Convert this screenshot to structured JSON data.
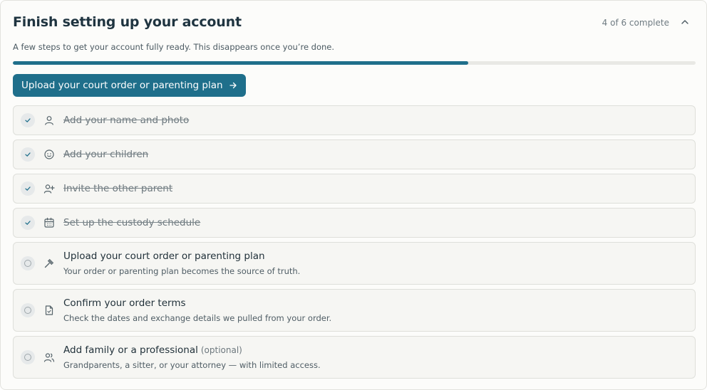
{
  "header": {
    "title": "Finish setting up your account",
    "progress_text": "4 of 6 complete",
    "subtitle": "A few steps to get your account fully ready. This disappears once you’re done.",
    "collapse_icon": "chevron-up-icon"
  },
  "progress": {
    "completed": 4,
    "total": 6,
    "fraction": 0.667
  },
  "cta": {
    "label": "Upload your court order or parenting plan",
    "icon": "arrow-right-icon"
  },
  "steps": [
    {
      "label": "Add your name and photo",
      "status": "complete",
      "icon": "user-icon"
    },
    {
      "label": "Add your children",
      "status": "complete",
      "icon": "smile-icon"
    },
    {
      "label": "Invite the other parent",
      "status": "complete",
      "icon": "user-plus-icon"
    },
    {
      "label": "Set up the custody schedule",
      "status": "complete",
      "icon": "calendar-icon"
    },
    {
      "label": "Upload your court order or parenting plan",
      "status": "incomplete",
      "icon": "gavel-icon",
      "description": "Your order or parenting plan becomes the source of truth."
    },
    {
      "label": "Confirm your order terms",
      "status": "incomplete",
      "icon": "file-check-icon",
      "description": "Check the dates and exchange details we pulled from your order."
    },
    {
      "label": "Add family or a professional",
      "optional_tag": "(optional)",
      "status": "incomplete",
      "icon": "users-icon",
      "description": "Grandparents, a sitter, or your attorney — with limited access."
    }
  ],
  "colors": {
    "accent": "#1f6f8b",
    "track": "#e9e9e5",
    "check": "#1f6f8b"
  }
}
